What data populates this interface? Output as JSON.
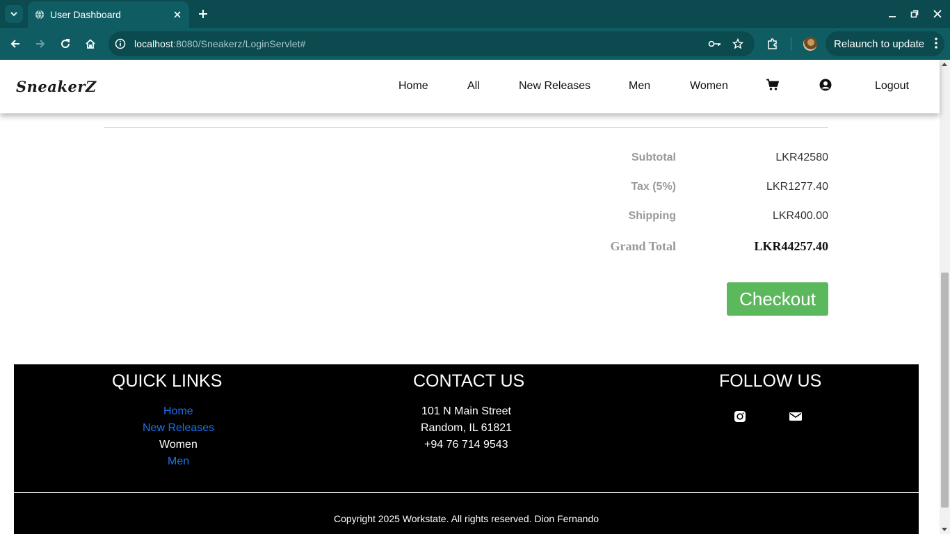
{
  "browser": {
    "tab_title": "User Dashboard",
    "url_host": "localhost",
    "url_rest": ":8080/Sneakerz/LoginServlet#",
    "relaunch_label": "Relaunch to update",
    "icons": [
      "tab-dropdown-icon",
      "globe-icon",
      "close-icon",
      "plus-icon",
      "minimize-icon",
      "restore-icon",
      "back-icon",
      "forward-icon",
      "reload-icon",
      "home-icon",
      "info-icon",
      "key-icon",
      "star-icon",
      "extensions-icon",
      "menu-dots-icon"
    ]
  },
  "site": {
    "logo": "SneakerZ",
    "nav": {
      "home": "Home",
      "all": "All",
      "new_releases": "New Releases",
      "men": "Men",
      "women": "Women",
      "logout": "Logout"
    },
    "nav_icons": [
      "cart-icon",
      "user-circle-icon"
    ]
  },
  "summary": {
    "subtotal_label": "Subtotal",
    "subtotal_value": "LKR42580",
    "tax_label": "Tax (5%)",
    "tax_value": "LKR1277.40",
    "shipping_label": "Shipping",
    "shipping_value": "LKR400.00",
    "grand_label": "Grand Total",
    "grand_value": "LKR44257.40",
    "checkout_label": "Checkout"
  },
  "footer": {
    "quick_links_title": "QUICK LINKS",
    "links": {
      "home": "Home",
      "new_releases": "New Releases",
      "women": "Women",
      "men": "Men"
    },
    "contact_title": "CONTACT US",
    "address_line1": "101 N Main Street",
    "address_line2": "Random, IL 61821",
    "phone": "+94 76 714 9543",
    "follow_title": "FOLLOW US",
    "social_icons": [
      "instagram-icon",
      "email-icon"
    ],
    "copyright": "Copyright 2025 Workstate. All rights reserved. Dion Fernando"
  },
  "colors": {
    "chrome_dark": "#0b4a4f",
    "chrome_mid": "#0f5c62",
    "link_blue": "#1a73e8",
    "checkout_green": "#5cb85c",
    "label_gray": "#999999",
    "footer_bg": "#000000"
  }
}
